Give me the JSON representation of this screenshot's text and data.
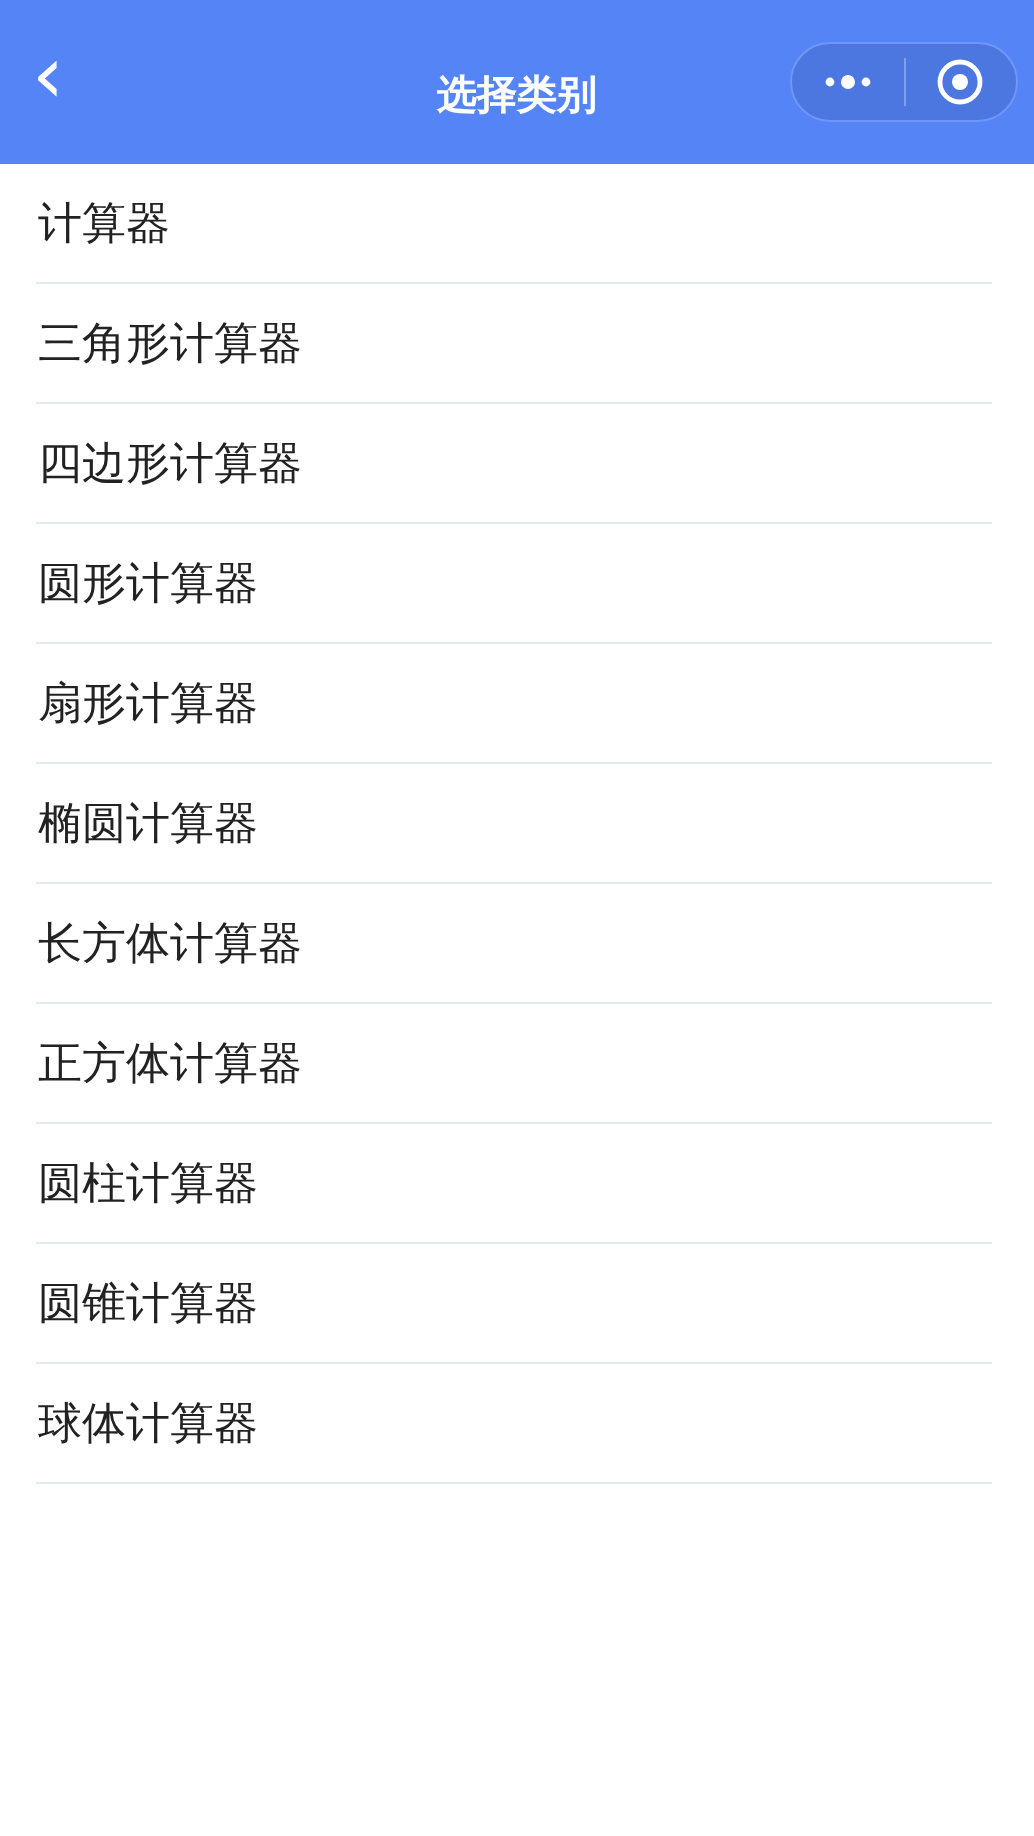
{
  "header": {
    "back": "‹",
    "title": "选择类别"
  },
  "items": [
    "计算器",
    "三角形计算器",
    "四边形计算器",
    "圆形计算器",
    "扇形计算器",
    "椭圆计算器",
    "长方体计算器",
    "正方体计算器",
    "圆柱计算器",
    "圆锥计算器",
    "球体计算器"
  ]
}
